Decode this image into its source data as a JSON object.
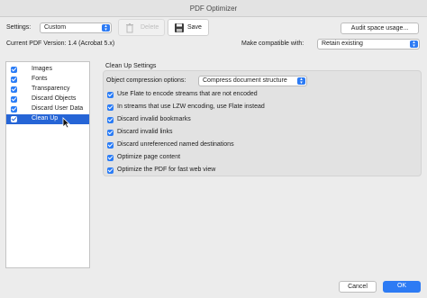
{
  "window": {
    "title": "PDF Optimizer"
  },
  "toolbar": {
    "settings_label": "Settings:",
    "settings_value": "Custom",
    "delete_label": "Delete",
    "save_label": "Save",
    "audit_label": "Audit space usage..."
  },
  "version": {
    "current_text": "Current PDF Version: 1.4 (Acrobat 5.x)",
    "compat_label": "Make compatible with:",
    "compat_value": "Retain existing"
  },
  "sidebar": {
    "items": [
      {
        "label": "Images",
        "checked": true
      },
      {
        "label": "Fonts",
        "checked": true
      },
      {
        "label": "Transparency",
        "checked": true
      },
      {
        "label": "Discard Objects",
        "checked": true
      },
      {
        "label": "Discard User Data",
        "checked": true
      },
      {
        "label": "Clean Up",
        "checked": true,
        "selected": true
      }
    ]
  },
  "cleanup": {
    "section_title": "Clean Up Settings",
    "compression_label": "Object compression options:",
    "compression_value": "Compress document structure",
    "options": [
      {
        "label": "Use Flate to encode streams that are not encoded",
        "checked": true
      },
      {
        "label": "In streams that use LZW encoding, use Flate instead",
        "checked": true
      },
      {
        "label": "Discard invalid bookmarks",
        "checked": true
      },
      {
        "label": "Discard invalid links",
        "checked": true
      },
      {
        "label": "Discard unreferenced named destinations",
        "checked": true
      },
      {
        "label": "Optimize page content",
        "checked": true
      },
      {
        "label": "Optimize the PDF for fast web view",
        "checked": true
      }
    ]
  },
  "footer": {
    "cancel_label": "Cancel",
    "ok_label": "OK"
  },
  "colors": {
    "accent": "#2d7bf4",
    "selection": "#2665d6",
    "background": "#ececec"
  }
}
